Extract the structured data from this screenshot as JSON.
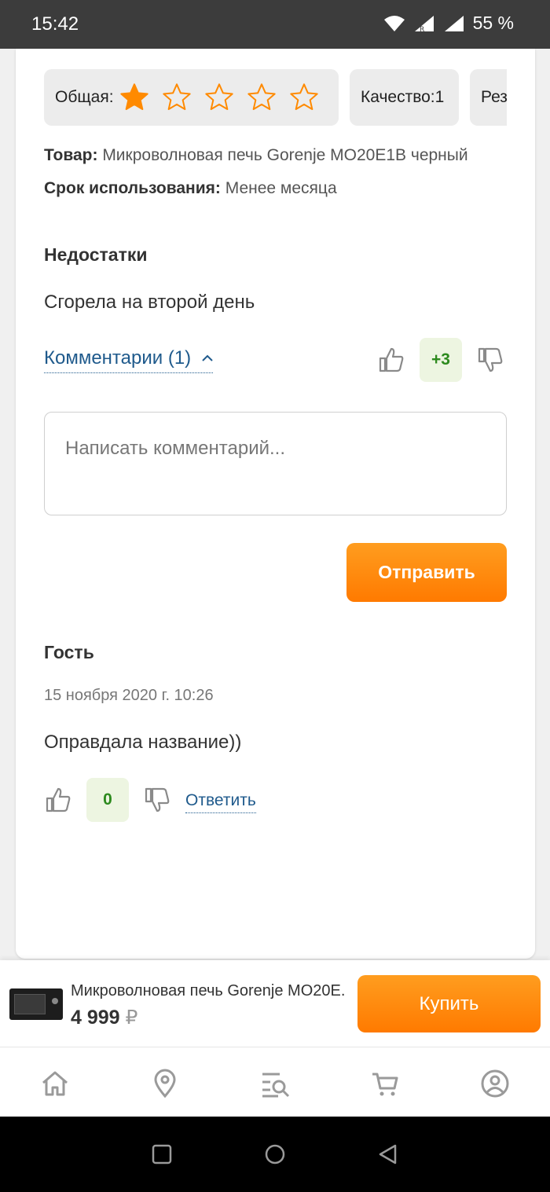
{
  "status_bar": {
    "time": "15:42",
    "battery": "55 %"
  },
  "ratings": {
    "overall_label": "Общая:",
    "overall_value": 1,
    "overall_max": 5,
    "quality_label": "Качество:1",
    "result_label": "Рез"
  },
  "product_info": {
    "product_label": "Товар:",
    "product_value": "Микроволновая печь Gorenje MO20E1B черный",
    "usage_label": "Срок использования:",
    "usage_value": "Менее месяца"
  },
  "cons": {
    "title": "Недостатки",
    "text": "Сгорела на второй день"
  },
  "review_votes": {
    "comments_link": "Комментарии (1)",
    "score": "+3"
  },
  "comment_form": {
    "placeholder": "Написать комментарий...",
    "submit_label": "Отправить"
  },
  "comment": {
    "author": "Гость",
    "date": "15 ноября 2020 г. 10:26",
    "text": "Оправдала название))",
    "score": "0",
    "reply_label": "Ответить"
  },
  "buy_bar": {
    "product_name": "Микроволновая печь Gorenje MO20E...",
    "price": "4 999",
    "currency": "₽",
    "buy_label": "Купить"
  },
  "colors": {
    "accent": "#ff8a00",
    "link": "#1f5a8c",
    "score_bg": "#edf5e1",
    "score_text": "#2d8a1e"
  },
  "nav_icons": [
    "home-icon",
    "location-icon",
    "catalog-search-icon",
    "cart-icon",
    "profile-icon"
  ]
}
